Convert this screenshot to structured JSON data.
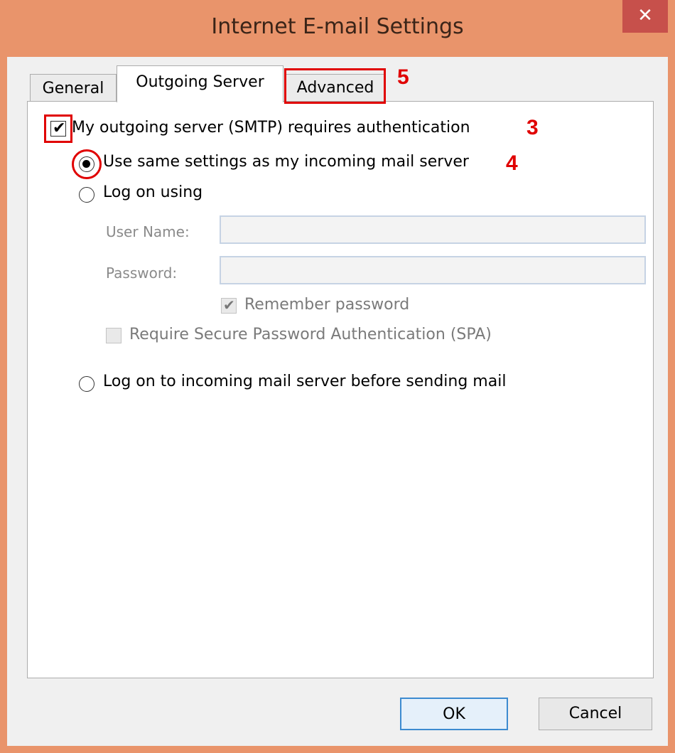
{
  "window": {
    "title": "Internet E-mail Settings",
    "close_label": "✕"
  },
  "tabs": [
    {
      "label": "General",
      "selected": false
    },
    {
      "label": "Outgoing Server",
      "selected": true
    },
    {
      "label": "Advanced",
      "selected": false
    }
  ],
  "annotations": {
    "callout_3": "3",
    "callout_4": "4",
    "callout_5": "5"
  },
  "smtp_auth": {
    "label": "My outgoing server (SMTP) requires authentication",
    "checked": true
  },
  "options": {
    "same_settings": {
      "label": "Use same settings as my incoming mail server",
      "selected": true
    },
    "log_on_using": {
      "label": "Log on using",
      "selected": false
    },
    "log_on_incoming": {
      "label": "Log on to incoming mail server before sending mail",
      "selected": false
    }
  },
  "credentials": {
    "user_name_label": "User Name:",
    "user_name_value": "",
    "password_label": "Password:",
    "password_value": "",
    "remember_password_label": "Remember password",
    "remember_password_checked": true,
    "spa_label": "Require Secure Password Authentication (SPA)",
    "spa_checked": false
  },
  "buttons": {
    "ok": "OK",
    "cancel": "Cancel"
  },
  "colors": {
    "window_frame": "#E9946B",
    "close_button": "#C7504B",
    "highlight_red": "#E00000"
  }
}
